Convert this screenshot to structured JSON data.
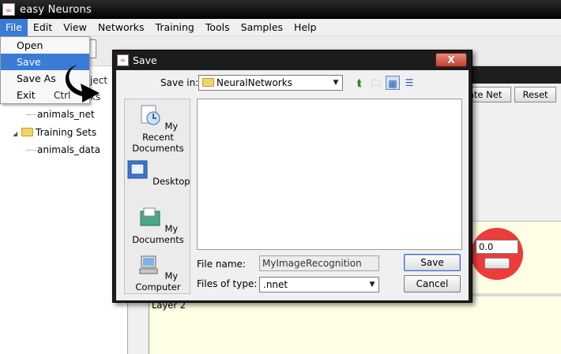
{
  "app": {
    "title": "easy Neurons"
  },
  "menubar": [
    "File",
    "Edit",
    "View",
    "Networks",
    "Training",
    "Tools",
    "Samples",
    "Help"
  ],
  "file_menu": {
    "items": [
      {
        "label": "Open",
        "selected": false
      },
      {
        "label": "Save",
        "selected": true
      },
      {
        "label": "Save As",
        "selected": false
      },
      {
        "label": "Exit",
        "selected": false
      }
    ],
    "partial_texts": [
      "ject",
      "Ctrl",
      "ks"
    ]
  },
  "tree": {
    "network_item": "animals_net",
    "training_sets": "Training Sets",
    "data_item": "animals_data"
  },
  "editor": {
    "buttons": [
      "late Net",
      "Reset"
    ],
    "layer2_label": "Layer 2",
    "neuron_value": "0.0"
  },
  "save_dialog": {
    "title": "Save",
    "close_label": "X",
    "save_in_label": "Save in:",
    "save_in_value": "NeuralNetworks",
    "places": [
      "My Recent Documents",
      "Desktop",
      "My Documents",
      "My Computer"
    ],
    "file_name_label": "File name:",
    "file_name_value": "MyImageRecognition",
    "files_of_type_label": "Files of type:",
    "files_of_type_value": ".nnet",
    "save_button": "Save",
    "cancel_button": "Cancel"
  },
  "colors": {
    "selection": "#3a7bd5",
    "title_bar": "#000000",
    "layer_panel": "#ffffe6",
    "neuron": "#ee3b3b"
  },
  "icons": [
    "app-icon",
    "folder-icon",
    "up-folder-icon",
    "new-folder-icon",
    "list-view-icon",
    "details-view-icon",
    "recent-documents-icon",
    "desktop-icon",
    "my-documents-icon",
    "my-computer-icon"
  ]
}
